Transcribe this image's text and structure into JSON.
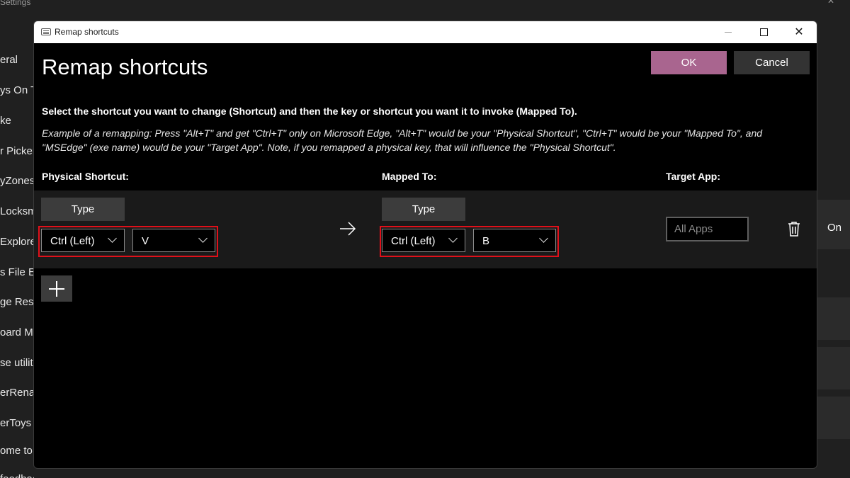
{
  "background": {
    "title": "Settings",
    "sidebar_items": [
      "eral",
      "ys On T",
      "ke",
      "r Picker",
      "yZones",
      "Locksmi",
      "Explorer",
      "s File Ec",
      "ge Resiz",
      "oard M",
      "se utilit",
      "erRenan",
      "erToys R",
      "ome to",
      "feedback"
    ],
    "toggle_state": "On"
  },
  "dialog": {
    "window_title": "Remap shortcuts",
    "heading": "Remap shortcuts",
    "ok_label": "OK",
    "cancel_label": "Cancel",
    "instructions": "Select the shortcut you want to change (Shortcut) and then the key or shortcut you want it to invoke (Mapped To).",
    "example": "Example of a remapping: Press \"Alt+T\" and get \"Ctrl+T\" only on Microsoft Edge, \"Alt+T\" would be your \"Physical Shortcut\", \"Ctrl+T\" would be your \"Mapped To\", and \"MSEdge\" (exe name) would be your \"Target App\". Note, if you remapped a physical key, that will influence the \"Physical Shortcut\".",
    "headers": {
      "physical": "Physical Shortcut:",
      "mapped": "Mapped To:",
      "target": "Target App:"
    },
    "row": {
      "physical_type_label": "Type",
      "physical_keys": [
        "Ctrl (Left)",
        "V"
      ],
      "mapped_type_label": "Type",
      "mapped_keys": [
        "Ctrl (Left)",
        "B"
      ],
      "target_app_placeholder": "All Apps"
    }
  },
  "colors": {
    "accent": "#a9658f",
    "highlight": "#e0101a"
  }
}
